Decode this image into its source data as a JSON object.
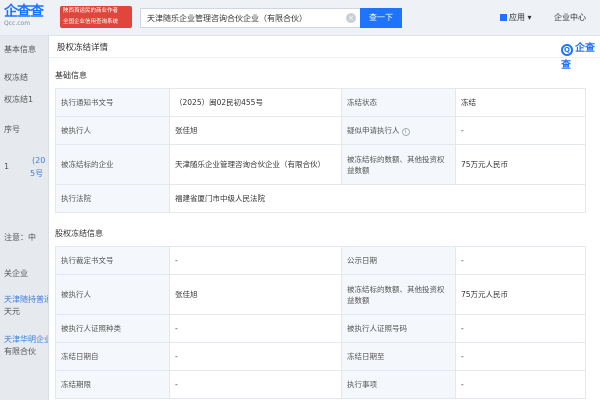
{
  "header": {
    "logo": "企查查",
    "logo_sub": "Qcc.com",
    "promo_line1": "陕西首运民的商业作者",
    "promo_line2": "全国企业信用查询系统",
    "search_value": "天津随乐企业管理咨询合伙企业（有限合伙）",
    "search_button": "查一下",
    "app_menu": "应用",
    "app_menu_caret": "▾",
    "center_menu": "企业中心"
  },
  "background": {
    "item1": "基本信息",
    "item2": "权冻结",
    "item3": "权冻结1",
    "item4": "序号",
    "item5": "1",
    "item6": "(20",
    "item7": "5号",
    "item8": "注意：中",
    "item9": "关企业",
    "item10": "天津随持普通",
    "item11": "天元",
    "item12": "天津华明企业",
    "item13": "有限合伙"
  },
  "modal": {
    "title": "股权冻结详情",
    "brand": "企查查",
    "brand_mark": "Q",
    "section1": {
      "title": "基础信息",
      "rows": [
        {
          "l1": "执行通知书文号",
          "v1": "（2025）闽02民初455号",
          "l2": "冻结状态",
          "v2": "冻结"
        },
        {
          "l1": "被执行人",
          "v1": "张佳旭",
          "l2": "疑似申请执行人",
          "help": "i",
          "v2": "-"
        },
        {
          "l1": "被冻结标的企业",
          "v1": "天津随乐企业管理咨询合伙企业（有限合伙）",
          "l2": "被冻结标的数额、其他投资权益数额",
          "v2": "75万元人民币"
        },
        {
          "l1": "执行法院",
          "v1": "福建省厦门市中级人民法院"
        }
      ]
    },
    "section2": {
      "title": "股权冻结信息",
      "rows": [
        {
          "l1": "执行裁定书文号",
          "v1": "-",
          "l2": "公示日期",
          "v2": "-"
        },
        {
          "l1": "被执行人",
          "v1": "张佳旭",
          "l2": "被冻结标的数额、其他投资权益数额",
          "v2": "75万元人民币"
        },
        {
          "l1": "被执行人证照种类",
          "v1": "-",
          "l2": "被执行人证照号码",
          "v2": "-"
        },
        {
          "l1": "冻结日期自",
          "v1": "-",
          "l2": "冻结日期至",
          "v2": "-"
        },
        {
          "l1": "冻结期限",
          "v1": "-",
          "l2": "执行事项",
          "v2": "-"
        }
      ]
    }
  },
  "colors": {
    "brand_blue": "#1f74ff",
    "link_blue": "#2f7bf5",
    "promo_red": "#e0463b",
    "label_bg": "#f4f7fb"
  },
  "icons": {
    "clear": "×",
    "brand_icon": "qcc-logo-icon",
    "help": "help-icon"
  }
}
